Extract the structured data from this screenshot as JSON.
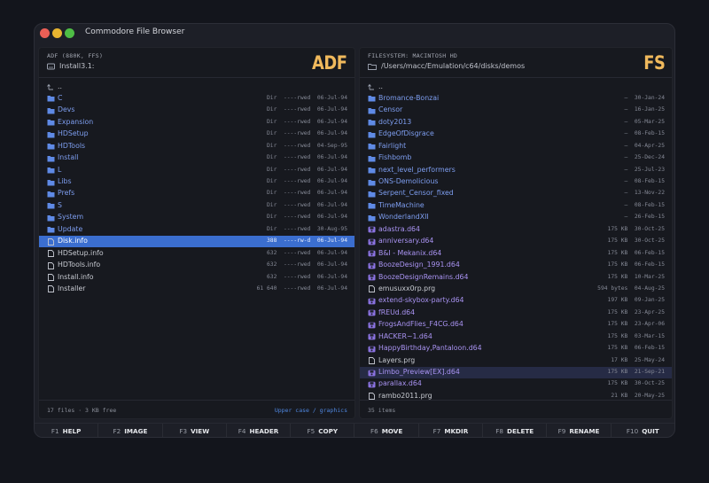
{
  "window": {
    "title": "Commodore File Browser"
  },
  "left": {
    "header_label": "ADF (880K, FFS)",
    "path": "Install3.1:",
    "badge": "ADF",
    "up": "..",
    "rows": [
      {
        "name": "C",
        "kind": "dir",
        "size": "Dir",
        "prot": "----rwed",
        "date": "06-Jul-94"
      },
      {
        "name": "Devs",
        "kind": "dir",
        "size": "Dir",
        "prot": "----rwed",
        "date": "06-Jul-94"
      },
      {
        "name": "Expansion",
        "kind": "dir",
        "size": "Dir",
        "prot": "----rwed",
        "date": "06-Jul-94"
      },
      {
        "name": "HDSetup",
        "kind": "dir",
        "size": "Dir",
        "prot": "----rwed",
        "date": "06-Jul-94"
      },
      {
        "name": "HDTools",
        "kind": "dir",
        "size": "Dir",
        "prot": "----rwed",
        "date": "04-Sep-95"
      },
      {
        "name": "Install",
        "kind": "dir",
        "size": "Dir",
        "prot": "----rwed",
        "date": "06-Jul-94"
      },
      {
        "name": "L",
        "kind": "dir",
        "size": "Dir",
        "prot": "----rwed",
        "date": "06-Jul-94"
      },
      {
        "name": "Libs",
        "kind": "dir",
        "size": "Dir",
        "prot": "----rwed",
        "date": "06-Jul-94"
      },
      {
        "name": "Prefs",
        "kind": "dir",
        "size": "Dir",
        "prot": "----rwed",
        "date": "06-Jul-94"
      },
      {
        "name": "S",
        "kind": "dir",
        "size": "Dir",
        "prot": "----rwed",
        "date": "06-Jul-94"
      },
      {
        "name": "System",
        "kind": "dir",
        "size": "Dir",
        "prot": "----rwed",
        "date": "06-Jul-94"
      },
      {
        "name": "Update",
        "kind": "dir",
        "size": "Dir",
        "prot": "----rwed",
        "date": "30-Aug-95"
      },
      {
        "name": "Disk.info",
        "kind": "info",
        "size": "388",
        "prot": "----rw-d",
        "date": "06-Jul-94",
        "selected": true
      },
      {
        "name": "HDSetup.info",
        "kind": "info",
        "size": "632",
        "prot": "----rwed",
        "date": "06-Jul-94"
      },
      {
        "name": "HDTools.info",
        "kind": "info",
        "size": "632",
        "prot": "----rwed",
        "date": "06-Jul-94"
      },
      {
        "name": "Install.info",
        "kind": "info",
        "size": "632",
        "prot": "----rwed",
        "date": "06-Jul-94"
      },
      {
        "name": "Installer",
        "kind": "info",
        "size": "61 640",
        "prot": "----rwed",
        "date": "06-Jul-94"
      }
    ],
    "footer_left": "17 files · 3 KB free",
    "footer_right": "Upper case / graphics"
  },
  "right": {
    "header_label": "FILESYSTEM: MACINTOSH HD",
    "path": "/Users/macc/Emulation/c64/disks/demos",
    "badge": "FS",
    "up": "..",
    "rows": [
      {
        "name": "Bromance-Bonzai",
        "kind": "dir",
        "size": "—",
        "date": "30-Jan-24"
      },
      {
        "name": "Censor",
        "kind": "dir",
        "size": "—",
        "date": "16-Jan-25"
      },
      {
        "name": "doty2013",
        "kind": "dir",
        "size": "—",
        "date": "05-Mar-25"
      },
      {
        "name": "EdgeOfDisgrace",
        "kind": "dir",
        "size": "—",
        "date": "08-Feb-15"
      },
      {
        "name": "Fairlight",
        "kind": "dir",
        "size": "—",
        "date": "04-Apr-25"
      },
      {
        "name": "Fishbomb",
        "kind": "dir",
        "size": "—",
        "date": "25-Dec-24"
      },
      {
        "name": "next_level_performers",
        "kind": "dir",
        "size": "—",
        "date": "25-Jul-23"
      },
      {
        "name": "ONS-Demolicious",
        "kind": "dir",
        "size": "—",
        "date": "08-Feb-15"
      },
      {
        "name": "Serpent_Censor_fixed",
        "kind": "dir",
        "size": "—",
        "date": "13-Nov-22"
      },
      {
        "name": "TimeMachine",
        "kind": "dir",
        "size": "—",
        "date": "08-Feb-15"
      },
      {
        "name": "WonderlandXII",
        "kind": "dir",
        "size": "—",
        "date": "26-Feb-15"
      },
      {
        "name": "adastra.d64",
        "kind": "d64",
        "size": "175 KB",
        "date": "30-Oct-25"
      },
      {
        "name": "anniversary.d64",
        "kind": "d64",
        "size": "175 KB",
        "date": "30-Oct-25"
      },
      {
        "name": "B&I - Mekanix.d64",
        "kind": "d64",
        "size": "175 KB",
        "date": "06-Feb-15"
      },
      {
        "name": "BoozeDesign_1991.d64",
        "kind": "d64",
        "size": "175 KB",
        "date": "06-Feb-15"
      },
      {
        "name": "BoozeDesignRemains.d64",
        "kind": "d64",
        "size": "175 KB",
        "date": "10-Mar-25"
      },
      {
        "name": "emusuxx0rp.prg",
        "kind": "prg",
        "size": "594 bytes",
        "date": "04-Aug-25"
      },
      {
        "name": "extend-skybox-party.d64",
        "kind": "d64",
        "size": "197 KB",
        "date": "09-Jan-25"
      },
      {
        "name": "fREUd.d64",
        "kind": "d64",
        "size": "175 KB",
        "date": "23-Apr-25"
      },
      {
        "name": "FrogsAndFlies_F4CG.d64",
        "kind": "d64",
        "size": "175 KB",
        "date": "23-Apr-06"
      },
      {
        "name": "HACKER~1.d64",
        "kind": "d64",
        "size": "175 KB",
        "date": "03-Mar-15"
      },
      {
        "name": "HappyBirthday,Pantaloon.d64",
        "kind": "d64",
        "size": "175 KB",
        "date": "06-Feb-15"
      },
      {
        "name": "Layers.prg",
        "kind": "prg",
        "size": "17 KB",
        "date": "25-May-24"
      },
      {
        "name": "Limbo_Preview[EX].d64",
        "kind": "d64",
        "size": "175 KB",
        "date": "21-Sep-21",
        "highlight": true
      },
      {
        "name": "parallax.d64",
        "kind": "d64",
        "size": "175 KB",
        "date": "30-Oct-25"
      },
      {
        "name": "rambo2011.prg",
        "kind": "prg",
        "size": "21 KB",
        "date": "20-May-25"
      }
    ],
    "footer_left": "35 items"
  },
  "fkeys": [
    {
      "key": "F1",
      "label": "HELP"
    },
    {
      "key": "F2",
      "label": "IMAGE"
    },
    {
      "key": "F3",
      "label": "VIEW"
    },
    {
      "key": "F4",
      "label": "HEADER"
    },
    {
      "key": "F5",
      "label": "COPY"
    },
    {
      "key": "F6",
      "label": "MOVE"
    },
    {
      "key": "F7",
      "label": "MKDIR"
    },
    {
      "key": "F8",
      "label": "DELETE"
    },
    {
      "key": "F9",
      "label": "RENAME"
    },
    {
      "key": "F10",
      "label": "QUIT"
    }
  ],
  "colors": {
    "accent": "#f0b95c",
    "selection": "#3b6ecf",
    "dir": "#7e9ef0",
    "disk_image": "#a993f2"
  },
  "icons": {
    "dir": "folder-icon",
    "info": "file-icon",
    "d64": "disk-image-icon",
    "prg": "file-icon",
    "up": "parent-dir-icon",
    "path_left": "drive-icon",
    "path_right": "folder-icon"
  }
}
